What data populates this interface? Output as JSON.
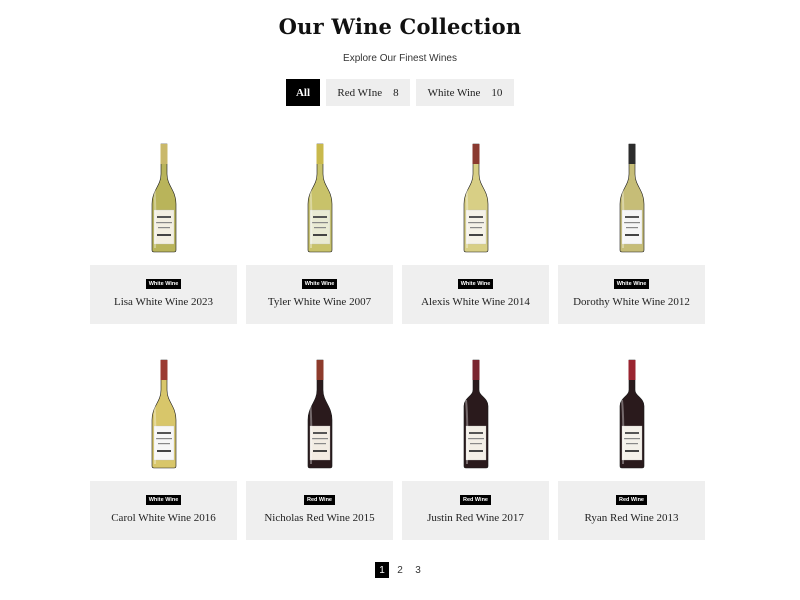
{
  "header": {
    "title": "Our Wine Collection",
    "subtitle": "Explore Our Finest Wines"
  },
  "filters": [
    {
      "label": "All",
      "count": null,
      "active": true
    },
    {
      "label": "Red WIne",
      "count": "8",
      "active": false
    },
    {
      "label": "White Wine",
      "count": "10",
      "active": false
    }
  ],
  "products": [
    {
      "badge": "White Wine",
      "name": "Lisa White Wine 2023",
      "bottle": {
        "glass": "#b9b45a",
        "neck": "#a7a04a",
        "label": "#f3efe2",
        "foil": "#c9b86a",
        "style": "burgundy"
      }
    },
    {
      "badge": "White Wine",
      "name": "Tyler White Wine 2007",
      "bottle": {
        "glass": "#c8c26a",
        "neck": "#b7ae52",
        "label": "#e9ead4",
        "foil": "#c9b94c",
        "style": "burgundy"
      }
    },
    {
      "badge": "White Wine",
      "name": "Alexis White Wine 2014",
      "bottle": {
        "glass": "#d8cf85",
        "neck": "#c7bd6a",
        "label": "#f5f2e8",
        "foil": "#8a3a30",
        "style": "burgundy"
      }
    },
    {
      "badge": "White Wine",
      "name": "Dorothy White Wine 2012",
      "bottle": {
        "glass": "#c6bd77",
        "neck": "#2c2c2c",
        "label": "#f6f6f6",
        "foil": "#2c2c2c",
        "style": "burgundy"
      }
    },
    {
      "badge": "White Wine",
      "name": "Carol White Wine 2016",
      "bottle": {
        "glass": "#d8c66a",
        "neck": "#9b3b32",
        "label": "#f7f7f7",
        "foil": "#9b3b32",
        "style": "burgundy"
      }
    },
    {
      "badge": "Red Wine",
      "name": "Nicholas Red Wine 2015",
      "bottle": {
        "glass": "#2a1a1c",
        "neck": "#8d3b2c",
        "label": "#f2ece3",
        "foil": "#8d3b2c",
        "style": "burgundy"
      }
    },
    {
      "badge": "Red Wine",
      "name": "Justin Red Wine 2017",
      "bottle": {
        "glass": "#2a1a1c",
        "neck": "#7a2530",
        "label": "#f3efe7",
        "foil": "#7a2530",
        "style": "bordeaux"
      }
    },
    {
      "badge": "Red Wine",
      "name": "Ryan Red Wine 2013",
      "bottle": {
        "glass": "#2a1a1c",
        "neck": "#9a2530",
        "label": "#f4f1ea",
        "foil": "#9a2530",
        "style": "bordeaux"
      }
    }
  ],
  "pagination": [
    "1",
    "2",
    "3"
  ],
  "colors": {
    "accent": "#000000",
    "card_bg": "#efefef",
    "filter_bg": "#eeeeee"
  }
}
